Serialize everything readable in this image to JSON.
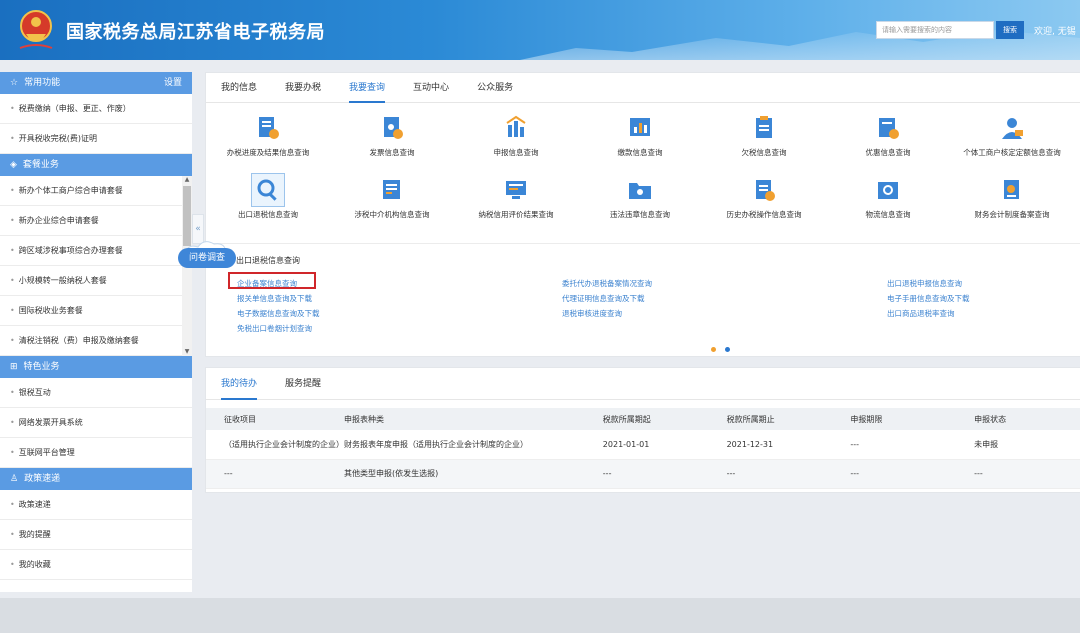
{
  "header": {
    "title": "国家税务总局江苏省电子税务局",
    "search_placeholder": "请输入需要搜索的内容",
    "search_button": "搜索",
    "welcome": "欢迎, 无锡"
  },
  "sidebar": {
    "sections": [
      {
        "title": "常用功能",
        "action": "设置",
        "icon": "star-icon",
        "items": [
          "税费缴纳（申报、更正、作废）",
          "开具税收完税(费)证明"
        ]
      },
      {
        "title": "套餐业务",
        "icon": "package-icon",
        "items": [
          "新办个体工商户综合申请套餐",
          "新办企业综合申请套餐",
          "跨区域涉税事项综合办理套餐",
          "小规模转一般纳税人套餐",
          "国际税收业务套餐",
          "清税注销税（费）申报及缴纳套餐"
        ]
      },
      {
        "title": "特色业务",
        "icon": "grid-icon",
        "items": [
          "银税互动",
          "网络发票开具系统",
          "互联网平台管理"
        ]
      },
      {
        "title": "政策速递",
        "icon": "user-icon",
        "items": [
          "政策速递",
          "我的提醒",
          "我的收藏"
        ]
      }
    ]
  },
  "main": {
    "tabs": [
      "我的信息",
      "我要办税",
      "我要查询",
      "互动中心",
      "公众服务"
    ],
    "active_tab": 2,
    "query_row1": [
      "办税进度及结果信息查询",
      "发票信息查询",
      "申报信息查询",
      "缴款信息查询",
      "欠税信息查询",
      "优惠信息查询",
      "个体工商户核定定额信息查询"
    ],
    "query_row2": [
      "出口退税信息查询",
      "涉税中介机构信息查询",
      "纳税信用评价结果查询",
      "违法违章信息查询",
      "历史办税操作信息查询",
      "物流信息查询",
      "财务会计制度备案查询"
    ],
    "sub_title": "出口退税信息查询",
    "links_col1": [
      "企业备案信息查询",
      "报关单信息查询及下载",
      "电子数据信息查询及下载",
      "免税出口卷烟计划查询"
    ],
    "links_col2": [
      "委托代办退税备案情况查询",
      "代理证明信息查询及下载",
      "退税审核进度查询"
    ],
    "links_col3": [
      "出口退税申报信息查询",
      "电子手册信息查询及下载",
      "出口商品退税率查询"
    ],
    "survey_badge": "问卷调查"
  },
  "todo": {
    "tabs": [
      "我的待办",
      "服务提醒"
    ],
    "active_tab": 0,
    "columns": [
      "征收项目",
      "申报表种类",
      "税款所属期起",
      "税款所属期止",
      "申报期限",
      "申报状态"
    ],
    "rows": [
      [
        "（适用执行企业会计制度的企业）",
        "财务报表年度申报（适用执行企业会计制度的企业）",
        "2021-01-01",
        "2021-12-31",
        "---",
        "未申报"
      ],
      [
        "---",
        "其他类型申报(依发生选报)",
        "---",
        "---",
        "---",
        "---"
      ]
    ]
  },
  "colors": {
    "accent": "#2a78cf",
    "sidebar_head": "#5a9be3",
    "highlight_box": "#d0262a",
    "link": "#3b82cf",
    "pager_active": "#f0a030",
    "pager_inactive": "#2a78cf"
  }
}
